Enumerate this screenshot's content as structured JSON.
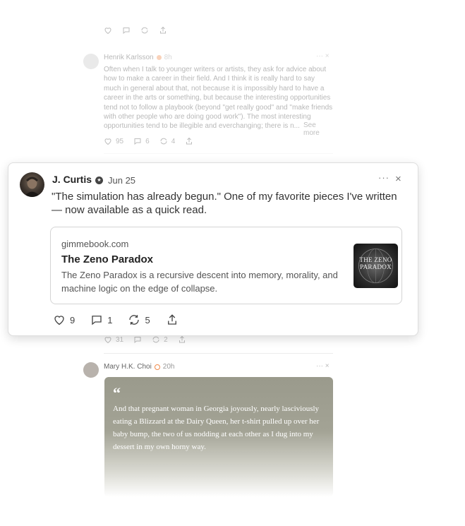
{
  "feed_top": {
    "actions": [
      "",
      "",
      "",
      ""
    ]
  },
  "feed_post_1": {
    "author": "Henrik Karlsson",
    "time": "8h",
    "body": "Often when I talk to younger writers or artists, they ask for advice about how to make a career in their field. And I think it is really hard to say much in general about that, not because it is impossibly hard to have a career in the arts or something, but because the interesting opportunities tend not to follow a playbook (beyond \"get really good\" and \"make friends with other people who are doing good work\"). The most interesting opportunities tend to be illegible and everchanging; there is n...",
    "see_more": "See more",
    "likes": "95",
    "comments": "6",
    "restacks": "4"
  },
  "feed_post_2": {
    "likes": "31",
    "comments": "",
    "restacks": "2"
  },
  "feed_post_3": {
    "author": "Mary H.K. Choi",
    "time": "20h",
    "quote_mark": "66",
    "quote": "And that pregnant woman in Georgia joyously, nearly lasciviously eating a Blizzard at the Dairy Queen, her t-shirt pulled up over her baby bump, the two of us nodding at each other as I dug into my dessert in my own horny way."
  },
  "popup": {
    "author": "J. Curtis",
    "date": "Jun 25",
    "text": "\"The simulation has already begun.\" One of my favorite pieces I've written — now available as a quick read.",
    "link": {
      "domain": "gimmebook.com",
      "title": "The Zeno Paradox",
      "description": "The Zeno Paradox is a recursive descent into memory, morality, and machine logic on the edge of collapse.",
      "thumb_text": "THE ZENO PARADOX"
    },
    "likes": "9",
    "comments": "1",
    "restacks": "5",
    "more_label": "···",
    "close_label": "×"
  },
  "colors": {
    "accent_verified": "#f08a4b",
    "quote_bg": "#9a9a8c"
  }
}
